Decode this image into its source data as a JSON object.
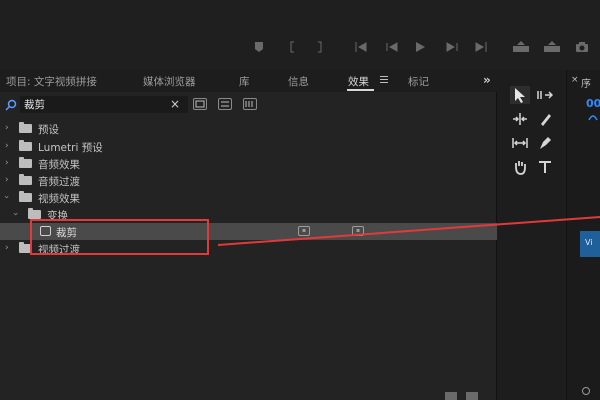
{
  "panel": {
    "tabs": [
      {
        "label": "项目: 文字视频拼接"
      },
      {
        "label": "媒体浏览器"
      },
      {
        "label": "库"
      },
      {
        "label": "信息"
      },
      {
        "label": "效果"
      },
      {
        "label": "标记"
      }
    ],
    "overflow": "»"
  },
  "search": {
    "value": "裁剪",
    "clear": "×"
  },
  "tree": [
    {
      "label": "预设",
      "icon": "folder-icon"
    },
    {
      "label": "Lumetri 预设",
      "icon": "folder-icon"
    },
    {
      "label": "音频效果",
      "icon": "folder-icon"
    },
    {
      "label": "音频过渡",
      "icon": "folder-icon"
    },
    {
      "label": "视频效果",
      "icon": "folder-icon"
    },
    {
      "label": "变换",
      "icon": "folder-icon"
    },
    {
      "label": "裁剪",
      "icon": "fx-effect-icon"
    },
    {
      "label": "视频过渡",
      "icon": "folder-icon"
    }
  ],
  "timeline": {
    "tab": "序",
    "close": "×",
    "timecode": "00",
    "track_label": "Vi"
  },
  "colors": {
    "accent_blue": "#2e8bff",
    "highlight_red": "#e23a3a",
    "selected_row": "#4a4a4a"
  }
}
